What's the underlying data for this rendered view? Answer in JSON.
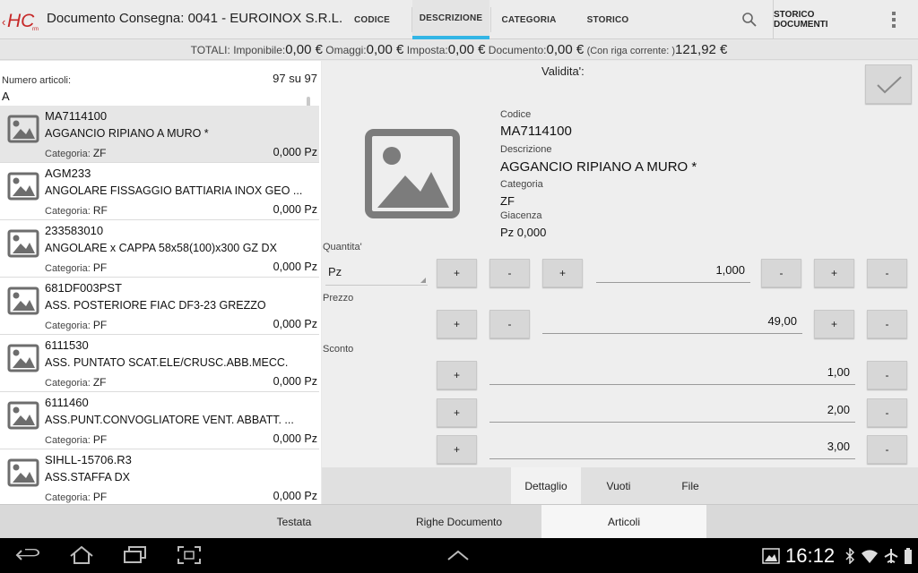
{
  "header": {
    "logo_text": "HCrm",
    "title": "Documento Consegna: 0041 - EUROINOX S.R.L.",
    "tabs": [
      {
        "label": "CODICE"
      },
      {
        "label": "DESCRIZIONE"
      },
      {
        "label": "CATEGORIA"
      },
      {
        "label": "STORICO"
      }
    ],
    "active_tab": "DESCRIZIONE",
    "storico_documenti": "STORICO DOCUMENTI",
    "accent_color": "#33b5e5"
  },
  "totals": {
    "label": "TOTALI:",
    "imponibile_label": "Imponibile:",
    "imponibile_value": "0,00 €",
    "omaggi_label": "Omaggi:",
    "omaggi_value": "0,00 €",
    "imposta_label": "Imposta:",
    "imposta_value": "0,00 €",
    "documento_label": "Documento:",
    "documento_value": "0,00 €",
    "riga_label": "(Con riga corrente: )",
    "riga_value": "121,92 €"
  },
  "list": {
    "count_label": "Numero articoli:",
    "count_value": "97 su 97",
    "filter": "A",
    "category_label": "Categoria:",
    "items": [
      {
        "code": "MA7114100",
        "desc": "AGGANCIO RIPIANO A MURO *",
        "cat": "ZF",
        "qty": "0,000 Pz"
      },
      {
        "code": "AGM233",
        "desc": "ANGOLARE FISSAGGIO BATTIARIA INOX GEO ...",
        "cat": "RF",
        "qty": "0,000 Pz"
      },
      {
        "code": "233583010",
        "desc": "ANGOLARE x CAPPA 58x58(100)x300 GZ DX",
        "cat": "PF",
        "qty": "0,000 Pz"
      },
      {
        "code": "681DF003PST",
        "desc": "ASS. POSTERIORE FIAC DF3-23 GREZZO",
        "cat": "PF",
        "qty": "0,000 Pz"
      },
      {
        "code": "6111530",
        "desc": "ASS. PUNTATO SCAT.ELE/CRUSC.ABB.MECC.",
        "cat": "ZF",
        "qty": "0,000 Pz"
      },
      {
        "code": "6111460",
        "desc": "ASS.PUNT.CONVOGLIATORE VENT. ABBATT. ...",
        "cat": "PF",
        "qty": "0,000 Pz"
      },
      {
        "code": "SIHLL-15706.R3",
        "desc": "ASS.STAFFA DX",
        "cat": "PF",
        "qty": "0,000 Pz"
      }
    ]
  },
  "detail": {
    "validita": "Validita':",
    "codice_label": "Codice",
    "codice_value": "MA7114100",
    "descrizione_label": "Descrizione",
    "descrizione_value": "AGGANCIO RIPIANO A MURO *",
    "categoria_label": "Categoria",
    "categoria_value": "ZF",
    "giacenza_label": "Giacenza",
    "giacenza_value": "Pz 0,000",
    "quantita_label": "Quantita'",
    "unit": "Pz",
    "quantita_value": "1,000",
    "prezzo_label": "Prezzo",
    "prezzo_value": "49,00",
    "sconto_label": "Sconto",
    "sconto_values": [
      "1,00",
      "2,00",
      "3,00"
    ],
    "plus": "+",
    "minus": "-",
    "subtabs": [
      "Dettaglio",
      "Vuoti",
      "File"
    ]
  },
  "bottom_tabs": [
    "Testata",
    "Righe Documento",
    "Articoli"
  ],
  "status": {
    "clock": "16:12"
  }
}
